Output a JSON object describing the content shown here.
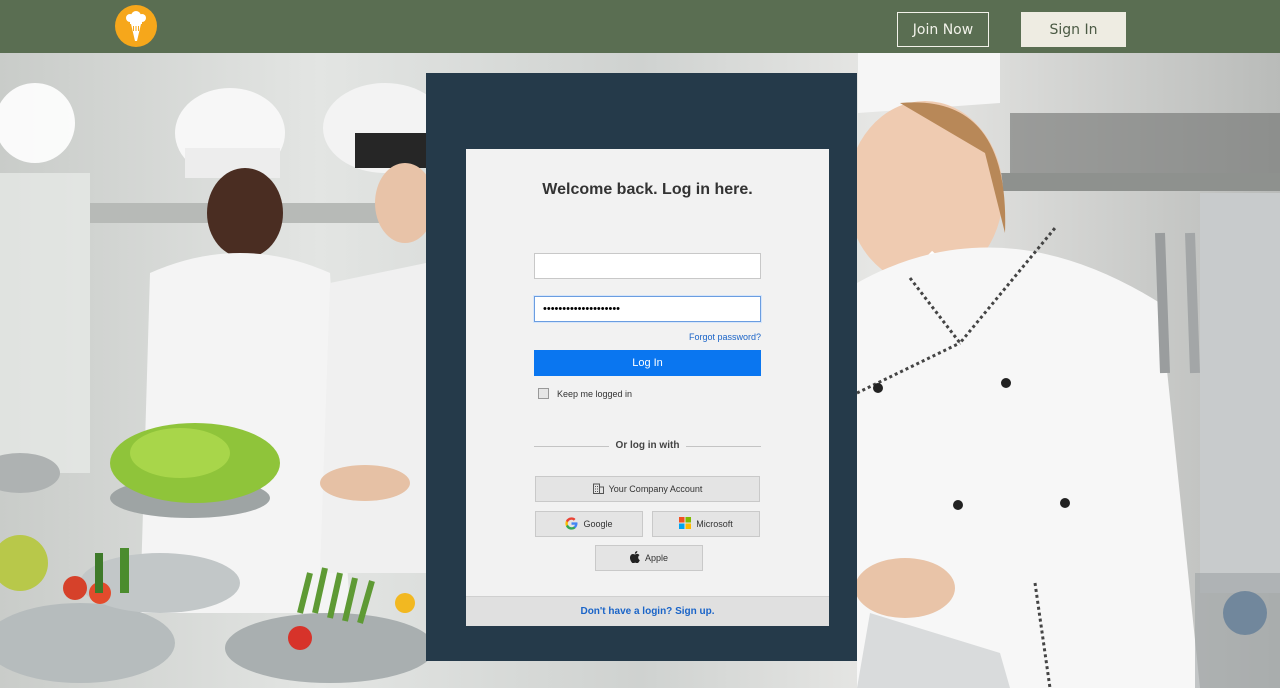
{
  "header": {
    "join_label": "Join Now",
    "signin_label": "Sign In",
    "logo_icon": "chef-hat-fork-icon",
    "bg_color": "#5a6e52"
  },
  "login": {
    "title": "Welcome back. Log in here.",
    "username_value": "",
    "password_value": "••••••••••••••••••••",
    "forgot_label": "Forgot password?",
    "login_label": "Log In",
    "keep_logged_in_label": "Keep me logged in",
    "keep_logged_in_checked": false,
    "or_label": "Or log in with",
    "sso": {
      "company_label": "Your Company Account",
      "google_label": "Google",
      "microsoft_label": "Microsoft",
      "apple_label": "Apple"
    },
    "signup_label": "Don't have a login? Sign up.",
    "accent_color": "#0a76f0",
    "panel_color": "#253a4a"
  }
}
